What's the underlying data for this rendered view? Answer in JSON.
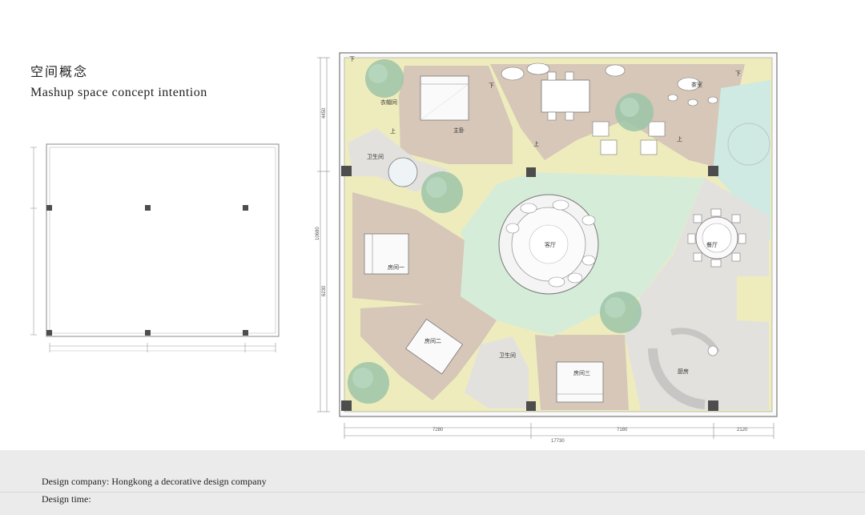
{
  "header": {
    "title_cn": "空间概念",
    "title_en": "Mashup space concept intention"
  },
  "footer": {
    "company": "Design company: Hongkong a decorative design company",
    "time": "Design time:"
  },
  "plan": {
    "labels": {
      "cloakroom": "衣帽间",
      "master_bedroom": "主卧",
      "tea_room": "茶室",
      "bathroom_1": "卫生间",
      "living_room": "客厅",
      "bedroom_1": "房间一",
      "bedroom_2": "房间二",
      "bathroom_2": "卫生间",
      "bedroom_3": "房间三",
      "dining_room": "餐厅",
      "kitchen": "厨房"
    },
    "dimensions": {
      "total_width": "17730",
      "segment_1": "7280",
      "segment_2": "7180",
      "segment_3": "2120",
      "total_height": "10680",
      "upper_height": "4450",
      "lower_height": "6230"
    },
    "stair_marks": {
      "up": "上",
      "down": "下"
    }
  },
  "colors": {
    "beige": "#d6c7b8",
    "yellow": "#eeecbd",
    "mint": "#d5ecd8",
    "lightgray": "#e3e1de",
    "aqua": "#cfe9e3",
    "pillar": "#4d4d4d",
    "footer_bg": "#ebebeb"
  }
}
